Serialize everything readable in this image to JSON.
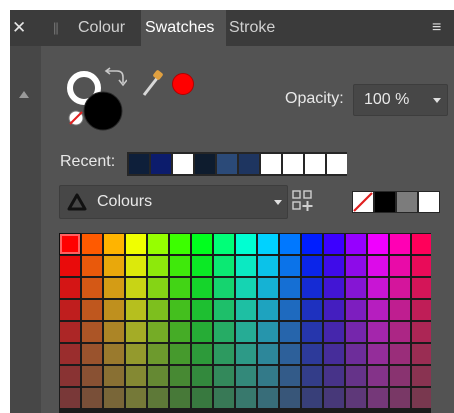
{
  "tabs": [
    {
      "label": "Colour",
      "active": false
    },
    {
      "label": "Swatches",
      "active": true
    },
    {
      "label": "Stroke",
      "active": false
    }
  ],
  "icons": {
    "close": "close-icon",
    "menu": "menu-icon",
    "swap": "swap-arrows-icon",
    "eyedropper": "eyedropper-icon",
    "none": "no-fill-icon",
    "add_swatch": "add-swatch-icon",
    "palette": "palette-triangle-icon",
    "scroll": "scroll-up-icon"
  },
  "colors": {
    "fill_primary": "#ffffff",
    "fill_secondary": "#000000",
    "picked": "#ff0000"
  },
  "opacity": {
    "label": "Opacity:",
    "value": "100 %"
  },
  "recent": {
    "label": "Recent:",
    "swatches": [
      "#0e1f3a",
      "#0c1c6c",
      "#ffffff",
      "#0e1c2e",
      "#2b4a78",
      "#1e3560",
      "#ffffff",
      "#ffffff",
      "#ffffff",
      "#ffffff"
    ]
  },
  "palette": {
    "selected": "Colours"
  },
  "quick_swatches": [
    "none",
    "#000000",
    "#7c7c7c",
    "#ffffff"
  ]
}
